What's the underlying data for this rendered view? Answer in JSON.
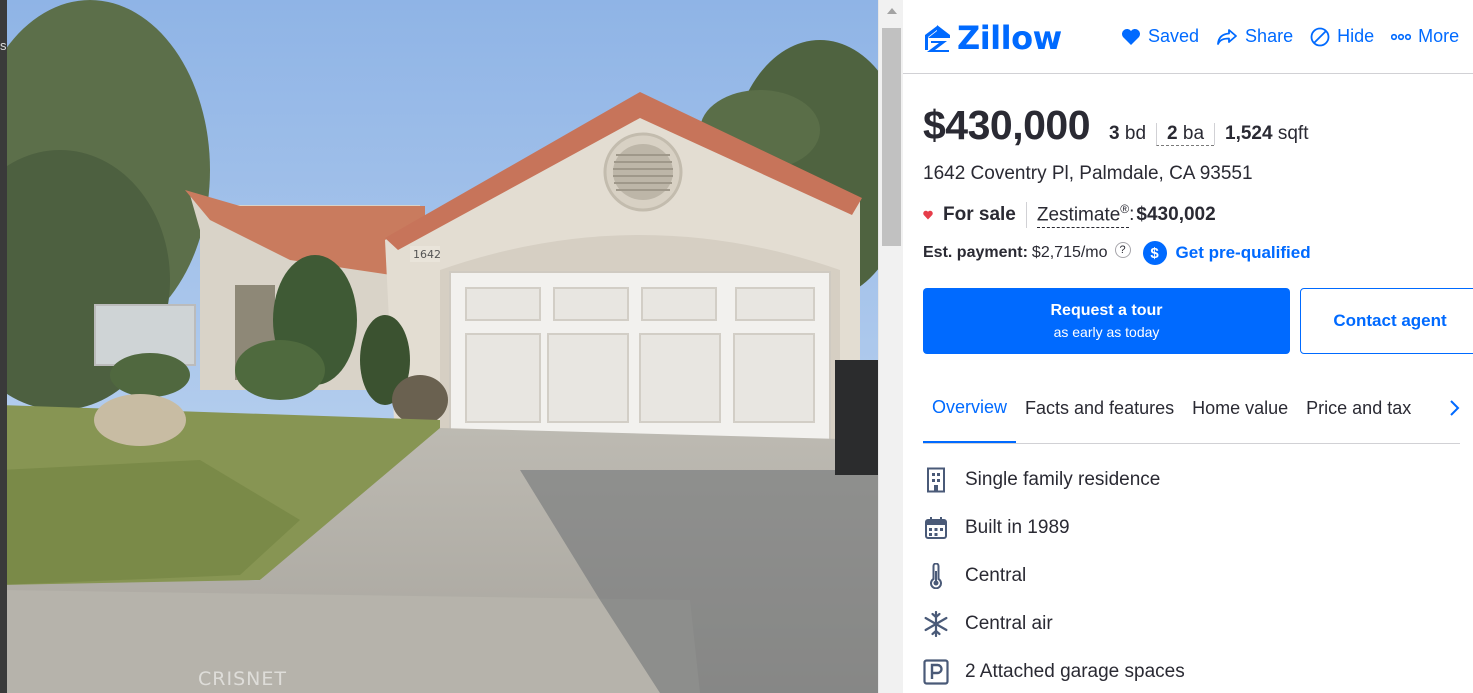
{
  "photo": {
    "edge_text": "s",
    "watermark": "CRISNET",
    "house_number": "1642"
  },
  "header": {
    "logo_text": "Zillow",
    "actions": [
      {
        "label": "Saved",
        "icon": "heart-icon"
      },
      {
        "label": "Share",
        "icon": "share-icon"
      },
      {
        "label": "Hide",
        "icon": "hide-icon"
      },
      {
        "label": "More",
        "icon": "more-icon"
      }
    ]
  },
  "listing": {
    "price": "$430,000",
    "beds_value": "3",
    "beds_unit": "bd",
    "baths_value": "2",
    "baths_unit": "ba",
    "sqft_value": "1,524",
    "sqft_unit": "sqft",
    "address": "1642 Coventry Pl, Palmdale, CA 93551",
    "status": "For sale",
    "zestimate_label": "Zestimate",
    "zestimate_mark": "®",
    "zestimate_colon": ":",
    "zestimate_value": "$430,002",
    "payment_label": "Est. payment:",
    "payment_value": "$2,715/mo",
    "help_mark": "?",
    "prequal_badge": "$",
    "prequal_label": "Get pre-qualified",
    "colors": {
      "accent": "#006aff",
      "status_dot": "#e63d4a",
      "text": "#2a2a33"
    }
  },
  "buttons": {
    "tour_main": "Request a tour",
    "tour_sub": "as early as today",
    "contact": "Contact agent"
  },
  "tabs": [
    {
      "label": "Overview",
      "active": true
    },
    {
      "label": "Facts and features",
      "active": false
    },
    {
      "label": "Home value",
      "active": false
    },
    {
      "label": "Price and tax",
      "active": false
    }
  ],
  "features": [
    {
      "icon": "building-icon",
      "label": "Single family residence"
    },
    {
      "icon": "calendar-icon",
      "label": "Built in 1989"
    },
    {
      "icon": "thermometer-icon",
      "label": "Central"
    },
    {
      "icon": "snowflake-icon",
      "label": "Central air"
    },
    {
      "icon": "parking-icon",
      "label": "2 Attached garage spaces"
    }
  ]
}
